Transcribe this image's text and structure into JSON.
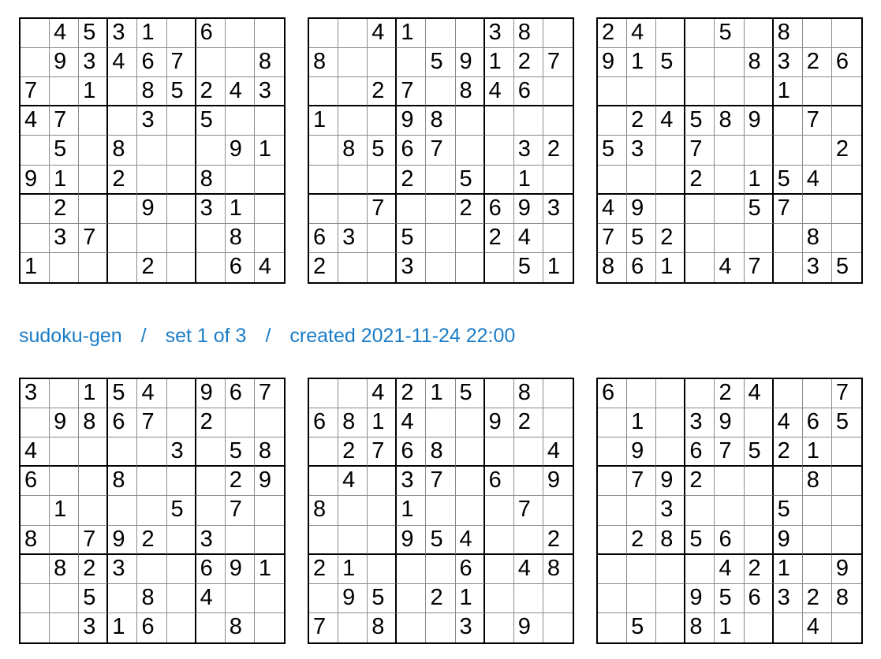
{
  "header": {
    "app_name": "sudoku-gen",
    "separator": "/",
    "set_label": "set 1 of 3",
    "created_label": "created 2021-11-24 22:00"
  },
  "colors": {
    "header_text": "#1a7cc6",
    "grid_thick": "#000000",
    "grid_thin": "#8a8a8a"
  },
  "puzzles": [
    [
      [
        "",
        "4",
        "5",
        "3",
        "1",
        "",
        "6",
        "",
        ""
      ],
      [
        "",
        "9",
        "3",
        "4",
        "6",
        "7",
        "",
        "",
        "8"
      ],
      [
        "7",
        "",
        "1",
        "",
        "8",
        "5",
        "2",
        "4",
        "3"
      ],
      [
        "4",
        "7",
        "",
        "",
        "3",
        "",
        "5",
        "",
        ""
      ],
      [
        "",
        "5",
        "",
        "8",
        "",
        "",
        "",
        "9",
        "1"
      ],
      [
        "9",
        "1",
        "",
        "2",
        "",
        "",
        "8",
        "",
        ""
      ],
      [
        "",
        "2",
        "",
        "",
        "9",
        "",
        "3",
        "1",
        ""
      ],
      [
        "",
        "3",
        "7",
        "",
        "",
        "",
        "",
        "8",
        ""
      ],
      [
        "1",
        "",
        "",
        "",
        "2",
        "",
        "",
        "6",
        "4"
      ]
    ],
    [
      [
        "",
        "",
        "4",
        "1",
        "",
        "",
        "3",
        "8",
        ""
      ],
      [
        "8",
        "",
        "",
        "",
        "5",
        "9",
        "1",
        "2",
        "7"
      ],
      [
        "",
        "",
        "2",
        "7",
        "",
        "8",
        "4",
        "6",
        ""
      ],
      [
        "1",
        "",
        "",
        "9",
        "8",
        "",
        "",
        "",
        ""
      ],
      [
        "",
        "8",
        "5",
        "6",
        "7",
        "",
        "",
        "3",
        "2"
      ],
      [
        "",
        "",
        "",
        "2",
        "",
        "5",
        "",
        "1",
        ""
      ],
      [
        "",
        "",
        "7",
        "",
        "",
        "2",
        "6",
        "9",
        "3"
      ],
      [
        "6",
        "3",
        "",
        "5",
        "",
        "",
        "2",
        "4",
        ""
      ],
      [
        "2",
        "",
        "",
        "3",
        "",
        "",
        "",
        "5",
        "1"
      ]
    ],
    [
      [
        "2",
        "4",
        "",
        "",
        "5",
        "",
        "8",
        "",
        ""
      ],
      [
        "9",
        "1",
        "5",
        "",
        "",
        "8",
        "3",
        "2",
        "6"
      ],
      [
        "",
        "",
        "",
        "",
        "",
        "",
        "1",
        "",
        ""
      ],
      [
        "",
        "2",
        "4",
        "5",
        "8",
        "9",
        "",
        "7",
        ""
      ],
      [
        "5",
        "3",
        "",
        "7",
        "",
        "",
        "",
        "",
        "2"
      ],
      [
        "",
        "",
        "",
        "2",
        "",
        "1",
        "5",
        "4",
        ""
      ],
      [
        "4",
        "9",
        "",
        "",
        "",
        "5",
        "7",
        "",
        ""
      ],
      [
        "7",
        "5",
        "2",
        "",
        "",
        "",
        "",
        "8",
        ""
      ],
      [
        "8",
        "6",
        "1",
        "",
        "4",
        "7",
        "",
        "3",
        "5"
      ]
    ],
    [
      [
        "3",
        "",
        "1",
        "5",
        "4",
        "",
        "9",
        "6",
        "7"
      ],
      [
        "",
        "9",
        "8",
        "6",
        "7",
        "",
        "2",
        "",
        ""
      ],
      [
        "4",
        "",
        "",
        "",
        "",
        "3",
        "",
        "5",
        "8"
      ],
      [
        "6",
        "",
        "",
        "8",
        "",
        "",
        "",
        "2",
        "9"
      ],
      [
        "",
        "1",
        "",
        "",
        "",
        "5",
        "",
        "7",
        ""
      ],
      [
        "8",
        "",
        "7",
        "9",
        "2",
        "",
        "3",
        "",
        ""
      ],
      [
        "",
        "8",
        "2",
        "3",
        "",
        "",
        "6",
        "9",
        "1"
      ],
      [
        "",
        "",
        "5",
        "",
        "8",
        "",
        "4",
        "",
        ""
      ],
      [
        "",
        "",
        "3",
        "1",
        "6",
        "",
        "",
        "8",
        ""
      ]
    ],
    [
      [
        "",
        "",
        "4",
        "2",
        "1",
        "5",
        "",
        "8",
        ""
      ],
      [
        "6",
        "8",
        "1",
        "4",
        "",
        "",
        "9",
        "2",
        ""
      ],
      [
        "",
        "2",
        "7",
        "6",
        "8",
        "",
        "",
        "",
        "4"
      ],
      [
        "",
        "4",
        "",
        "3",
        "7",
        "",
        "6",
        "",
        "9"
      ],
      [
        "8",
        "",
        "",
        "1",
        "",
        "",
        "",
        "7",
        ""
      ],
      [
        "",
        "",
        "",
        "9",
        "5",
        "4",
        "",
        "",
        "2"
      ],
      [
        "2",
        "1",
        "",
        "",
        "",
        "6",
        "",
        "4",
        "8"
      ],
      [
        "",
        "9",
        "5",
        "",
        "2",
        "1",
        "",
        "",
        ""
      ],
      [
        "7",
        "",
        "8",
        "",
        "",
        "3",
        "",
        "9",
        ""
      ]
    ],
    [
      [
        "6",
        "",
        "",
        "",
        "2",
        "4",
        "",
        "",
        "7"
      ],
      [
        "",
        "1",
        "",
        "3",
        "9",
        "",
        "4",
        "6",
        "5"
      ],
      [
        "",
        "9",
        "",
        "6",
        "7",
        "5",
        "2",
        "1",
        ""
      ],
      [
        "",
        "7",
        "9",
        "2",
        "",
        "",
        "",
        "8",
        ""
      ],
      [
        "",
        "",
        "3",
        "",
        "",
        "",
        "5",
        "",
        ""
      ],
      [
        "",
        "2",
        "8",
        "5",
        "6",
        "",
        "9",
        "",
        ""
      ],
      [
        "",
        "",
        "",
        "",
        "4",
        "2",
        "1",
        "",
        "9"
      ],
      [
        "",
        "",
        "",
        "9",
        "5",
        "6",
        "3",
        "2",
        "8"
      ],
      [
        "",
        "5",
        "",
        "8",
        "1",
        "",
        "",
        "4",
        ""
      ]
    ]
  ]
}
